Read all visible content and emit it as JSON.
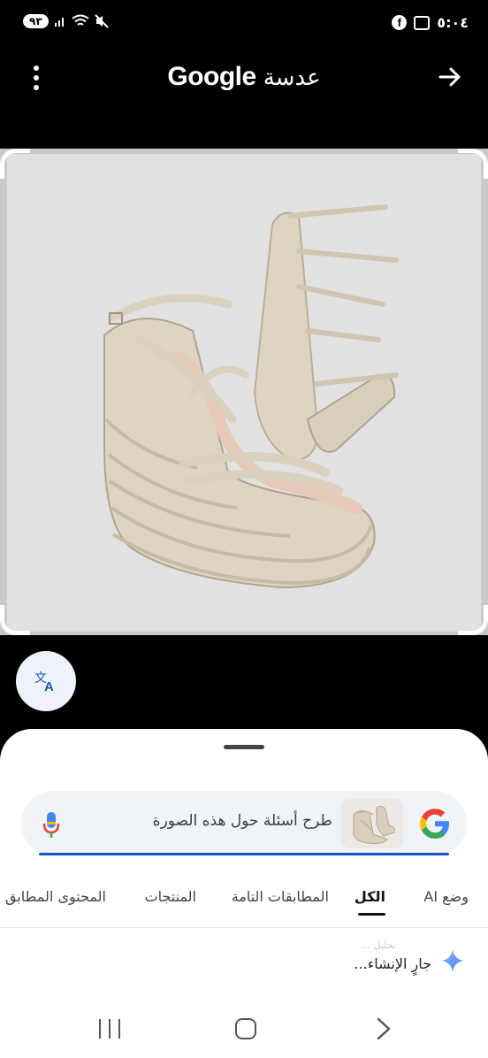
{
  "status_bar": {
    "battery": "٩٣",
    "time": "٥:٠٤",
    "signal_icon": "signal-icon",
    "wifi_icon": "wifi-icon",
    "mute_icon": "mute-icon",
    "facebook_glyph": "f"
  },
  "app_bar": {
    "title_brand": "Google",
    "title_product": "عدسة"
  },
  "search": {
    "placeholder": "طرح أسئلة حول هذه الصورة"
  },
  "tabs": [
    {
      "label": "وضع AI",
      "active": false
    },
    {
      "label": "الكل",
      "active": true
    },
    {
      "label": "المطابقات التامة",
      "active": false
    },
    {
      "label": "المنتجات",
      "active": false
    },
    {
      "label": "المحتوى المطابق",
      "active": false
    }
  ],
  "generating": {
    "faded_text": "تحليل ...",
    "label": "جارٍ الإنشاء..."
  },
  "colors": {
    "accent": "#1a56b8",
    "sheet_bg": "#ffffff",
    "search_bg": "#f0f3f8"
  }
}
